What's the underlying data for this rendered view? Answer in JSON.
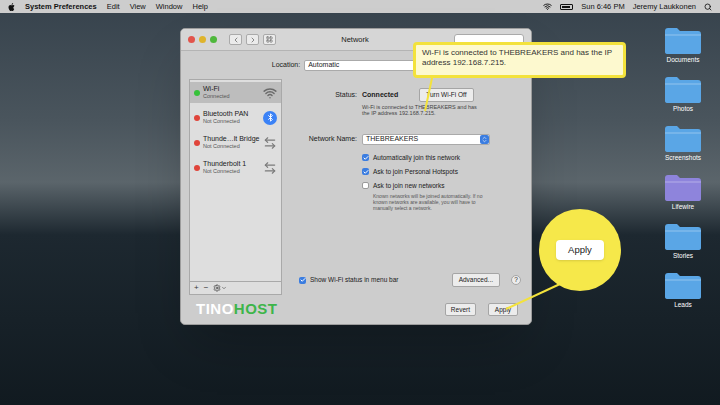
{
  "menu_bar": {
    "app": "System Preferences",
    "menus": [
      "Edit",
      "View",
      "Window",
      "Help"
    ],
    "clock": "Sun 6:46 PM",
    "user": "Jeremy Laukkonen"
  },
  "desktop_folders": [
    {
      "label": "Documents",
      "color": "#5aa6e6"
    },
    {
      "label": "Photos",
      "color": "#5aa6e6"
    },
    {
      "label": "Screenshots",
      "color": "#5aa6e6"
    },
    {
      "label": "Lifewire",
      "color": "#8e84dc"
    },
    {
      "label": "Stories",
      "color": "#5aa6e6"
    },
    {
      "label": "Leads",
      "color": "#5aa6e6"
    }
  ],
  "window": {
    "title": "Network"
  },
  "location": {
    "label": "Location:",
    "value": "Automatic"
  },
  "services": [
    {
      "name": "Wi-Fi",
      "status": "Connected",
      "selected": true,
      "color": "#37c23a",
      "kind": "wifi"
    },
    {
      "name": "Bluetooth PAN",
      "status": "Not Connected",
      "selected": false,
      "color": "#e0443a",
      "kind": "bluetooth"
    },
    {
      "name": "Thunde…lt Bridge",
      "status": "Not Connected",
      "selected": false,
      "color": "#e0443a",
      "kind": "thunderbolt"
    },
    {
      "name": "Thunderbolt 1",
      "status": "Not Connected",
      "selected": false,
      "color": "#e0443a",
      "kind": "thunderbolt"
    }
  ],
  "sidebar_buttons": [
    "+",
    "−"
  ],
  "status": {
    "label": "Status:",
    "value": "Connected",
    "button": "Turn Wi-Fi Off",
    "description": "Wi-Fi is connected to THEBREAKERS and has the IP address 192.168.7.215."
  },
  "network_name": {
    "label": "Network Name:",
    "value": "THEBREAKERS"
  },
  "options": [
    {
      "label": "Automatically join this network",
      "checked": true
    },
    {
      "label": "Ask to join Personal Hotspots",
      "checked": true
    },
    {
      "label": "Ask to join new networks",
      "checked": false
    }
  ],
  "options_note": "Known networks will be joined automatically. If no known networks are available, you will have to manually select a network.",
  "show_status": {
    "label": "Show Wi-Fi status in menu bar",
    "checked": true
  },
  "advanced": "Advanced...",
  "help": "?",
  "buttons": [
    "Revert",
    "Apply"
  ],
  "callouts": [
    {
      "text": "Wi-Fi is connected to THEBREAKERS and has the IP address 192.168.7.215."
    },
    {
      "text": "Apply"
    }
  ],
  "watermark": [
    {
      "text": "TINO",
      "color": "#ffffff"
    },
    {
      "text": "HOST",
      "color": "#3db54a"
    }
  ]
}
